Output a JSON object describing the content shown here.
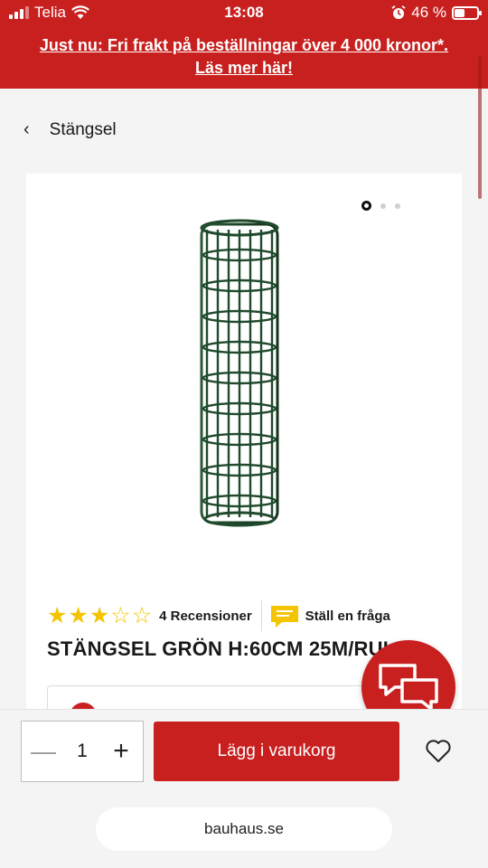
{
  "status_bar": {
    "carrier": "Telia",
    "time": "13:08",
    "battery": "46 %",
    "battery_level": 0.46
  },
  "promo": {
    "line1": "Just nu: Fri frakt på beställningar över 4 000 kronor*.",
    "line2": "Läs mer här!"
  },
  "breadcrumb": {
    "label": "Stängsel"
  },
  "gallery": {
    "image_count": 3,
    "active_index": 0
  },
  "product": {
    "rating": 3,
    "rating_max": 5,
    "reviews_label": "4 Recensioner",
    "ask_label": "Ställ en fråga",
    "title": "STÄNGSEL GRÖN H:60CM 25M/RULLE"
  },
  "cart": {
    "quantity": "1",
    "add_label": "Lägg i varukorg"
  },
  "browser": {
    "url": "bauhaus.se"
  },
  "colors": {
    "brand_red": "#c8201f",
    "star_yellow": "#f4c400",
    "fence_green": "#1f4a2c"
  }
}
